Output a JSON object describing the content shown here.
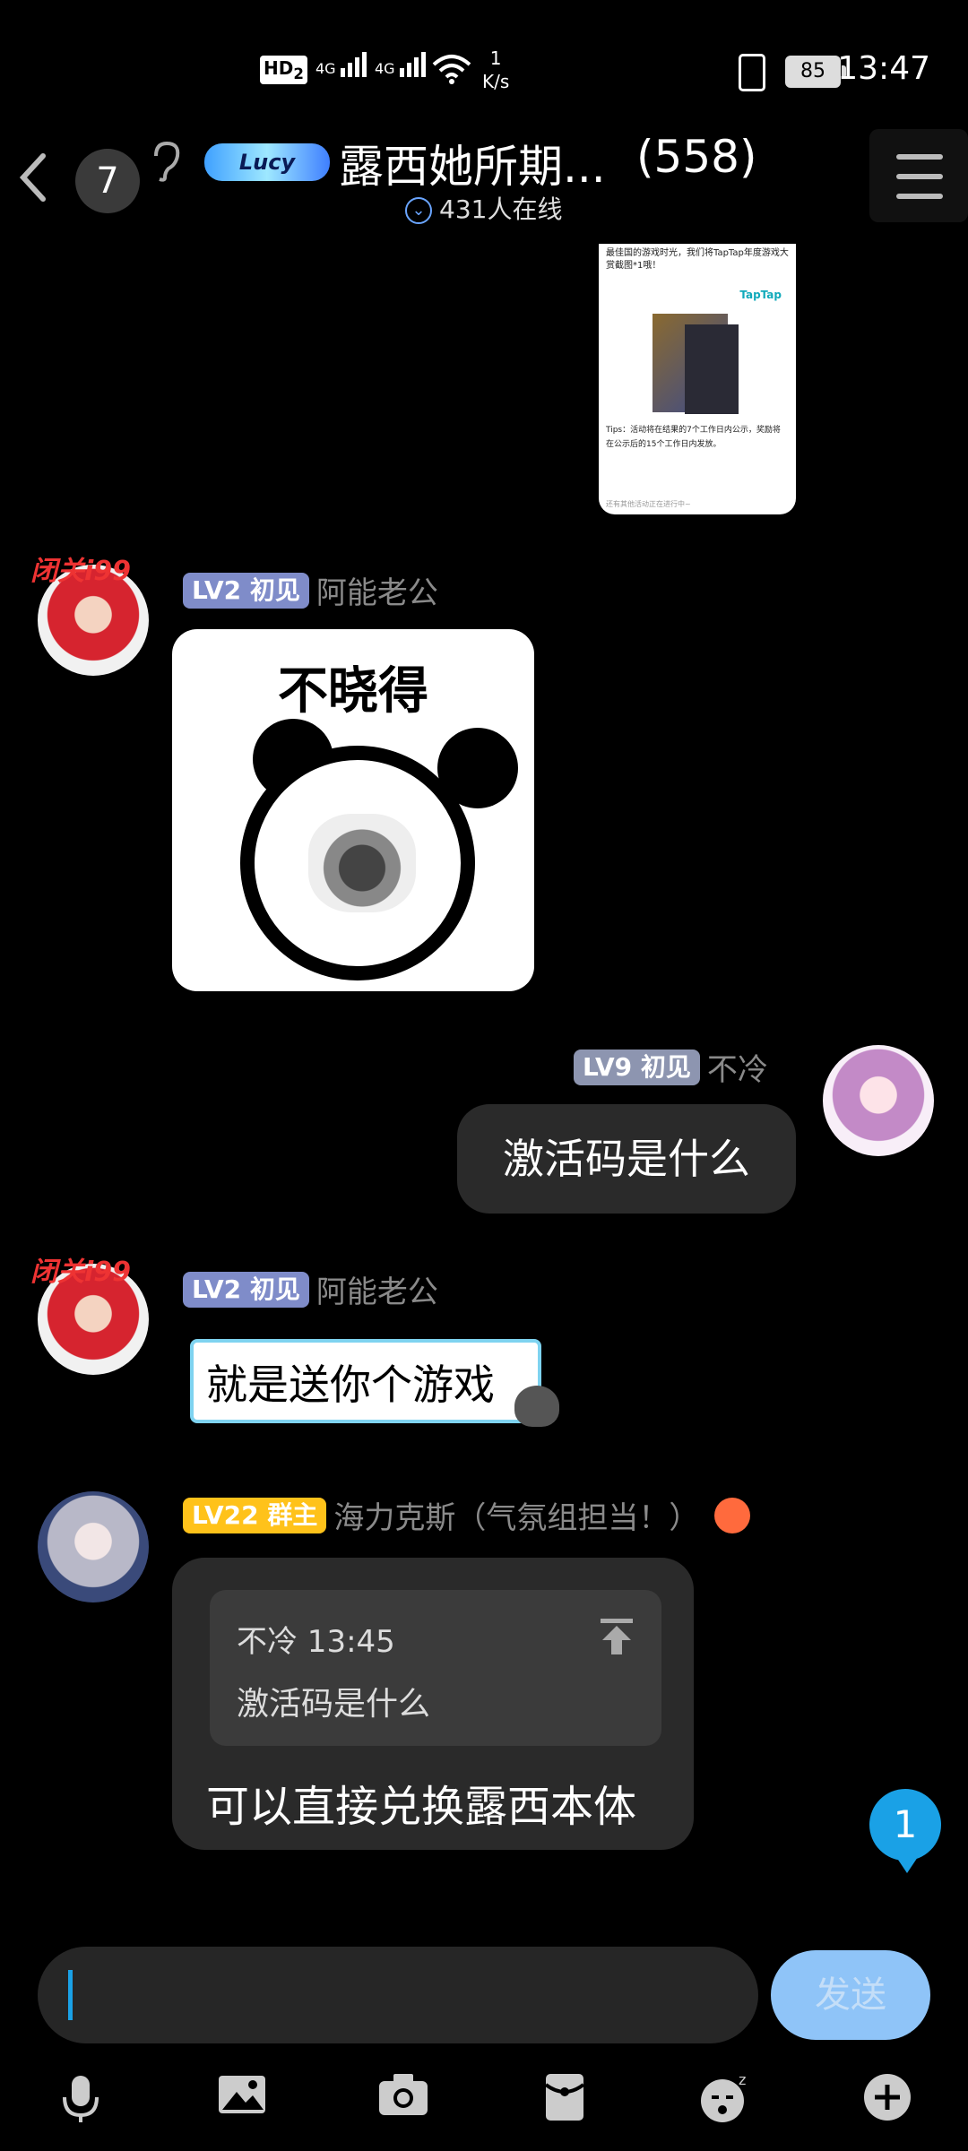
{
  "status_bar": {
    "hd": "HD",
    "hd_sub": "2",
    "network1": "4G",
    "network2": "4G",
    "speed_value": "1",
    "speed_unit": "K/s",
    "battery": "85",
    "time": "13:47"
  },
  "header": {
    "back_icon": "chevron-left",
    "unread_count": "7",
    "logo_text": "Lucy",
    "group_name": "露西她所期...",
    "member_count": "(558)",
    "online_text": "431人在线"
  },
  "shared_card": {
    "top_text": "最佳国的游戏时光，我们将TapTap年度游戏大赏截图*1哦！",
    "brand": "TapTap",
    "tips": "Tips：活动将在结果的7个工作日内公示，奖励将在公示后的15个工作日内发放。",
    "foot": "还有其他活动正在进行中~"
  },
  "messages": [
    {
      "level": "LV2",
      "tag": "初见",
      "nickname": "阿能老公",
      "avatar_deco": "闭关i99",
      "meme_text": "不晓得"
    },
    {
      "level": "LV9",
      "tag": "初见",
      "nickname": "不冷",
      "text": "激活码是什么"
    },
    {
      "level": "LV2",
      "tag": "初见",
      "nickname": "阿能老公",
      "avatar_deco": "闭关i99",
      "text": "就是送你个游戏"
    },
    {
      "level": "LV22",
      "tag": "群主",
      "nickname": "海力克斯（气氛组担当！）",
      "quote_head": "不冷 13:45",
      "quote_text": "激活码是什么",
      "text": "可以直接兑换露西本体"
    }
  ],
  "new_message_badge": "1",
  "composer": {
    "send_label": "发送"
  },
  "toolbar": [
    "mic-icon",
    "image-icon",
    "camera-icon",
    "red-packet-icon",
    "emoji-icon",
    "plus-icon"
  ],
  "colors": {
    "accent": "#1aa1e6",
    "send_disabled": "#8fc4f8",
    "lv_blue": "#7f8cc9",
    "lv_gold": "#ffc21a"
  }
}
